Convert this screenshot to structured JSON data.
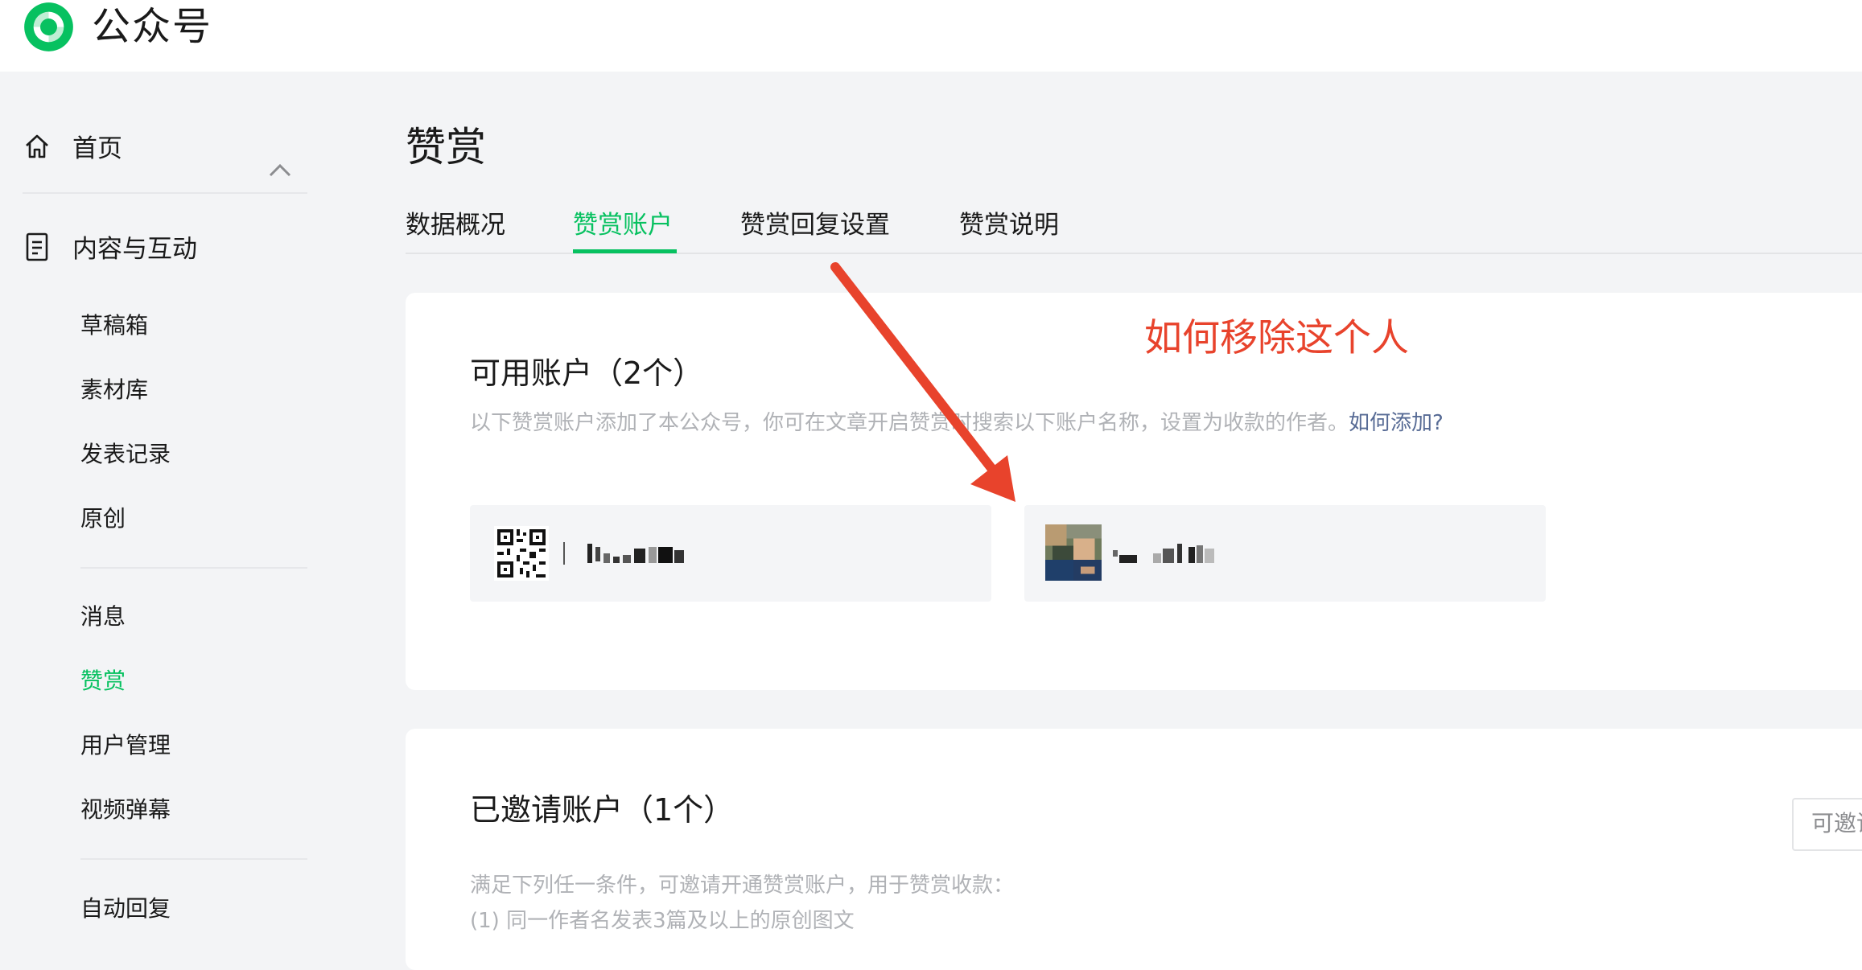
{
  "app": {
    "brand": "公众号"
  },
  "sidebar": {
    "home": "首页",
    "content_group": "内容与互动",
    "content_items": [
      "草稿箱",
      "素材库",
      "发表记录",
      "原创"
    ],
    "interaction_items": [
      "消息",
      "赞赏",
      "用户管理",
      "视频弹幕"
    ],
    "auto_reply": "自动回复",
    "active_item": "赞赏"
  },
  "page": {
    "title": "赞赏",
    "tabs": [
      "数据概况",
      "赞赏账户",
      "赞赏回复设置",
      "赞赏说明"
    ],
    "active_tab": "赞赏账户"
  },
  "available": {
    "title": "可用账户（2个）",
    "description": "以下赞赏账户添加了本公众号，你可在文章开启赞赏时搜索以下账户名称，设置为收款的作者。",
    "help_link": "如何添加?"
  },
  "invited": {
    "title": "已邀请账户（1个）",
    "description_line1": "满足下列任一条件，可邀请开通赞赏账户，用于赞赏收款：",
    "description_line2": "(1) 同一作者名发表3篇及以上的原创图文",
    "invite_button": "可邀请"
  },
  "annotation": {
    "text": "如何移除这个人"
  },
  "colors": {
    "accent": "#07c160",
    "link": "#576b95",
    "annotation": "#e8432c"
  },
  "icons": [
    "wechat-logo-icon",
    "home-icon",
    "document-icon",
    "chevron-up-icon",
    "qr-code-icon"
  ]
}
